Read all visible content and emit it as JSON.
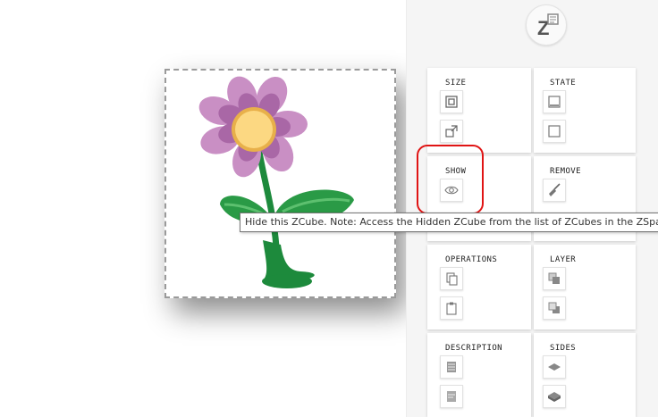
{
  "canvas": {
    "zcube_image": "flower-illustration"
  },
  "logo": {
    "icon": "zspace-logo-icon"
  },
  "panel": {
    "cards": [
      {
        "title": "SIZE",
        "buttons": [
          "resize-fit-icon",
          "resize-expand-icon"
        ]
      },
      {
        "title": "STATE",
        "buttons": [
          "state-minimize-icon",
          "state-maximize-icon"
        ]
      },
      {
        "title": "SHOW",
        "buttons": [
          "eye-icon"
        ]
      },
      {
        "title": "REMOVE",
        "buttons": [
          "broom-icon"
        ]
      },
      {
        "title": "OPERATIONS",
        "buttons": [
          "copy-icon",
          "paste-icon"
        ]
      },
      {
        "title": "LAYER",
        "buttons": [
          "bring-forward-icon",
          "send-backward-icon"
        ]
      },
      {
        "title": "DESCRIPTION",
        "buttons": [
          "description-icon",
          "description-edit-icon"
        ]
      },
      {
        "title": "SIDES",
        "buttons": [
          "sides-flat-icon",
          "sides-3d-icon"
        ]
      }
    ]
  },
  "tooltip": {
    "text": "Hide this ZCube. Note: Access the Hidden ZCube from the list of ZCubes in the ZSpace"
  },
  "colors": {
    "highlight": "#e01414",
    "petal_light": "#c98fc4",
    "petal_dark": "#a967a6",
    "flower_center": "#fcd882",
    "leaf_green": "#2a9a46",
    "stem_green": "#1d8a3c"
  }
}
